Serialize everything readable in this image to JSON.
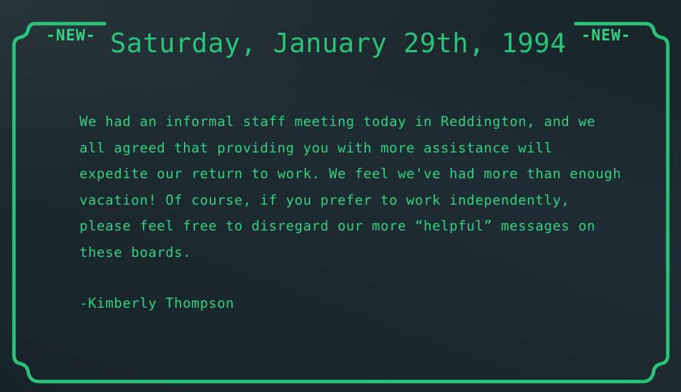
{
  "board": {
    "tag_left": "-NEW-",
    "tag_right": "-NEW-",
    "date": "Saturday, January 29th, 1994",
    "message": "We had an informal staff meeting today in Reddington, and we all agreed that providing you with more assistance will expedite our return to work. We feel we've had more than enough vacation! Of course, if you prefer to work independently, please feel free to disregard our more “helpful” messages on these boards.",
    "signature": "-Kimberly Thompson"
  },
  "colors": {
    "accent": "#2bc27a",
    "text": "#33d081",
    "background": "#1a292f"
  }
}
